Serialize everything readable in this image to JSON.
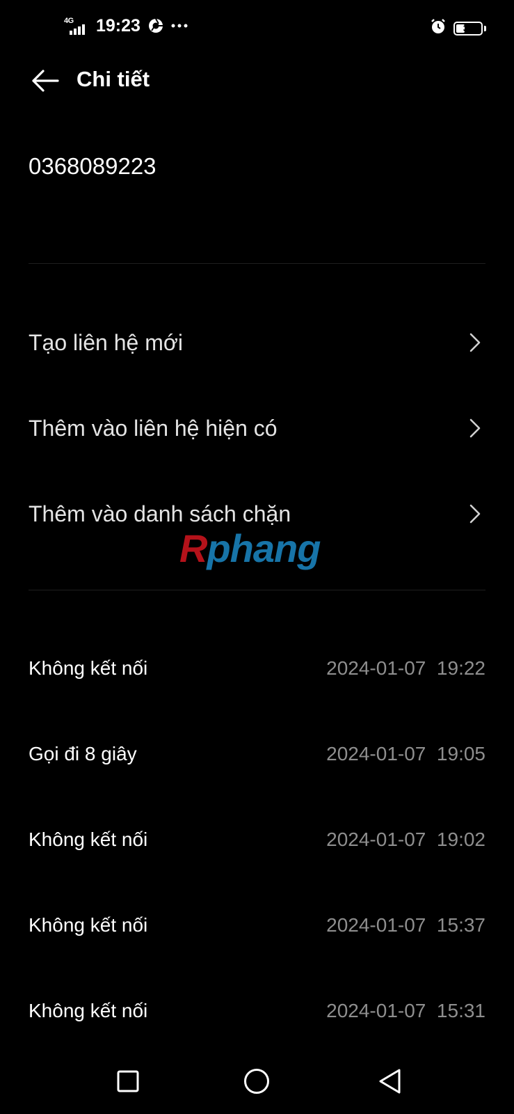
{
  "status_bar": {
    "network": "4G",
    "time": "19:23",
    "battery_level": "32",
    "icons": [
      "signal-icon",
      "vpn-shield-icon",
      "more-dots-icon",
      "alarm-icon",
      "battery-icon"
    ]
  },
  "header": {
    "title": "Chi tiết",
    "back_icon": "arrow-left-icon"
  },
  "contact": {
    "phone_number": "0368089223"
  },
  "actions": [
    {
      "label": "Tạo liên hệ mới",
      "icon": "chevron-right-icon"
    },
    {
      "label": "Thêm vào liên hệ hiện có",
      "icon": "chevron-right-icon"
    },
    {
      "label": "Thêm vào danh sách chặn",
      "icon": "chevron-right-icon"
    }
  ],
  "watermark": {
    "first_letter": "R",
    "rest": "phang",
    "colors": {
      "first": "#b4121a",
      "rest": "#1774a8"
    }
  },
  "call_log": [
    {
      "status": "Không kết nối",
      "timestamp": "2024-01-07  19:22"
    },
    {
      "status": "Gọi đi 8 giây",
      "timestamp": "2024-01-07  19:05"
    },
    {
      "status": "Không kết nối",
      "timestamp": "2024-01-07  19:02"
    },
    {
      "status": "Không kết nối",
      "timestamp": "2024-01-07  15:37"
    },
    {
      "status": "Không kết nối",
      "timestamp": "2024-01-07  15:31"
    }
  ],
  "nav_bar": {
    "buttons": [
      "recents-square-icon",
      "home-circle-icon",
      "back-triangle-icon"
    ]
  },
  "colors": {
    "background": "#000000",
    "primary_text": "#ffffff",
    "secondary_text": "#8e8e8e",
    "divider": "#1f1f1f"
  }
}
